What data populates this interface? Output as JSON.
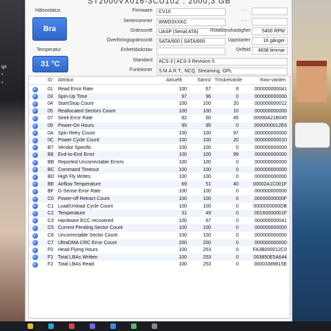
{
  "window_title": "ST2000VX016-3CU102 : 2000,3 GB",
  "status": {
    "health_label": "Hälsostatus",
    "health_value": "Bra",
    "temperature_label": "Temperatur",
    "temperature_value": "31 °C"
  },
  "info": {
    "firmware_label": "Firmware",
    "firmware": "CV10",
    "serial_label": "Serienummer",
    "serial": "WWD3XXKC",
    "interface_label": "Gränssnitt",
    "interface": "UASP (Serial ATA)",
    "transfer_label": "Överföringsgränssnitt",
    "transfer": "SATA/600 | SATA/600",
    "drive_letter_label": "Enhetsbokstav",
    "drive_letter": "",
    "standard_label": "Standard",
    "standard": "ACS-3 | ACS-3 Revision 5",
    "features_label": "Funktioner",
    "features": "S.M.A.R.T., NCQ, Streaming, GPL",
    "dash1": "----",
    "dash2": "----",
    "rotation_label": "Rotationshastighet",
    "rotation": "5400 RPM",
    "powerups_label": "Uppstarter",
    "powerups": "16 gånger",
    "poweron_label": "Drifttid",
    "poweron": "4838 timmar"
  },
  "table": {
    "headers": {
      "id": "ID",
      "attribute": "Attribut",
      "current": "Aktuellt",
      "worst": "Sämst",
      "threshold": "Tröskelvärde",
      "raw": "Raw-värden"
    },
    "rows": [
      {
        "id": "01",
        "name": "Read Error Rate",
        "cur": "100",
        "worst": "67",
        "thr": "6",
        "raw": "000000000041"
      },
      {
        "id": "03",
        "name": "Spin-Up Time",
        "cur": "97",
        "worst": "96",
        "thr": "0",
        "raw": "000000000000"
      },
      {
        "id": "04",
        "name": "Start/Stop Count",
        "cur": "100",
        "worst": "100",
        "thr": "20",
        "raw": "000000000012"
      },
      {
        "id": "05",
        "name": "Reallocated Sectors Count",
        "cur": "100",
        "worst": "100",
        "thr": "10",
        "raw": "000000000000"
      },
      {
        "id": "07",
        "name": "Seek Error Rate",
        "cur": "82",
        "worst": "60",
        "thr": "45",
        "raw": "00000A21B045"
      },
      {
        "id": "09",
        "name": "Power-On Hours",
        "cur": "95",
        "worst": "95",
        "thr": "0",
        "raw": "0000000012E6"
      },
      {
        "id": "0A",
        "name": "Spin Retry Count",
        "cur": "100",
        "worst": "100",
        "thr": "97",
        "raw": "000000000000"
      },
      {
        "id": "0C",
        "name": "Power Cycle Count",
        "cur": "100",
        "worst": "100",
        "thr": "20",
        "raw": "000000000010"
      },
      {
        "id": "B7",
        "name": "Vendor Specific",
        "cur": "100",
        "worst": "100",
        "thr": "0",
        "raw": "000000000000"
      },
      {
        "id": "B8",
        "name": "End-to-End Error",
        "cur": "100",
        "worst": "100",
        "thr": "99",
        "raw": "000000000000"
      },
      {
        "id": "BB",
        "name": "Reported Uncorrectable Errors",
        "cur": "100",
        "worst": "100",
        "thr": "0",
        "raw": "000000000000"
      },
      {
        "id": "BC",
        "name": "Command Timeout",
        "cur": "100",
        "worst": "100",
        "thr": "0",
        "raw": "000000000000"
      },
      {
        "id": "BD",
        "name": "High Fly Writes",
        "cur": "100",
        "worst": "100",
        "thr": "0",
        "raw": "000000000000"
      },
      {
        "id": "BE",
        "name": "Airflow Temperature",
        "cur": "69",
        "worst": "51",
        "thr": "40",
        "raw": "00002A1C001F"
      },
      {
        "id": "BF",
        "name": "G-Sense Error Rate",
        "cur": "100",
        "worst": "100",
        "thr": "0",
        "raw": "000000000000"
      },
      {
        "id": "C0",
        "name": "Power-off Retract Count",
        "cur": "100",
        "worst": "100",
        "thr": "0",
        "raw": "00000000000F"
      },
      {
        "id": "C1",
        "name": "Load/Unload Cycle Count",
        "cur": "100",
        "worst": "100",
        "thr": "0",
        "raw": "0000000000DB"
      },
      {
        "id": "C2",
        "name": "Temperature",
        "cur": "31",
        "worst": "49",
        "thr": "0",
        "raw": "00160000001F"
      },
      {
        "id": "C3",
        "name": "Hardware ECC recovered",
        "cur": "100",
        "worst": "67",
        "thr": "0",
        "raw": "000000000041"
      },
      {
        "id": "C5",
        "name": "Current Pending Sector Count",
        "cur": "100",
        "worst": "100",
        "thr": "0",
        "raw": "000000000000"
      },
      {
        "id": "C6",
        "name": "Uncorrectable Sector Count",
        "cur": "100",
        "worst": "100",
        "thr": "0",
        "raw": "000000000000"
      },
      {
        "id": "C7",
        "name": "UltraDMA CRC Error Count",
        "cur": "200",
        "worst": "200",
        "thr": "0",
        "raw": "000000000000"
      },
      {
        "id": "F0",
        "name": "Head Flying Hours",
        "cur": "100",
        "worst": "253",
        "thr": "0",
        "raw": "FA3B000012C0"
      },
      {
        "id": "F1",
        "name": "Total LBAs Written",
        "cur": "100",
        "worst": "253",
        "thr": "0",
        "raw": "003850E5A644"
      },
      {
        "id": "F2",
        "name": "Total LBAs Read",
        "cur": "100",
        "worst": "253",
        "thr": "0",
        "raw": "00003389815E"
      }
    ]
  },
  "background": {
    "desk_text": [
      "ipt",
      "*",
      "*"
    ]
  }
}
